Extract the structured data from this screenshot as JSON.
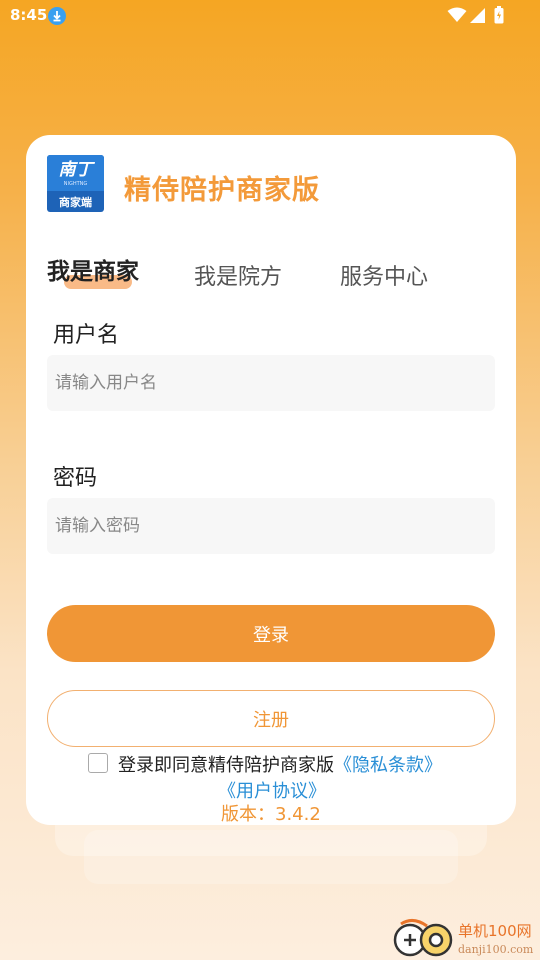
{
  "status_bar": {
    "time": "8:45"
  },
  "app": {
    "title": "精侍陪护商家版",
    "logo_top": "南丁",
    "logo_sub": "NIGHTNG",
    "logo_bottom": "商家端"
  },
  "tabs": [
    {
      "label": "我是商家",
      "active": true
    },
    {
      "label": "我是院方",
      "active": false
    },
    {
      "label": "服务中心",
      "active": false
    }
  ],
  "form": {
    "username_label": "用户名",
    "username_placeholder": "请输入用户名",
    "username_value": "",
    "password_label": "密码",
    "password_placeholder": "请输入密码",
    "password_value": ""
  },
  "buttons": {
    "login": "登录",
    "register": "注册"
  },
  "agreement": {
    "checked": false,
    "text": "登录即同意精侍陪护商家版",
    "privacy_link": "《隐私条款》",
    "user_agreement_link": "《用户协议》"
  },
  "version": "版本：3.4.2",
  "watermark": {
    "text": "单机100网",
    "sub": "danji100.com"
  },
  "colors": {
    "accent": "#f09636",
    "link": "#2a8fd6",
    "title": "#f39a3a"
  }
}
